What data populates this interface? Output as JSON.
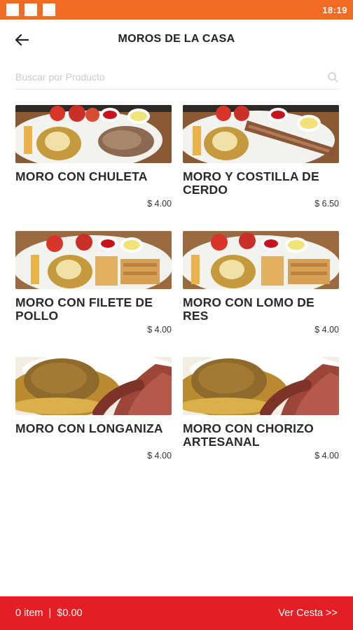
{
  "status_bar": {
    "time": "18:19",
    "color": "#f26b23"
  },
  "header": {
    "title": "MOROS DE LA CASA",
    "back_icon": "arrow-left-icon"
  },
  "search": {
    "placeholder": "Buscar por Producto",
    "value": ""
  },
  "products": [
    {
      "name": "MORO CON CHULETA",
      "price": "$ 4.00",
      "image": "moro-chuleta"
    },
    {
      "name": "MORO Y COSTILLA DE CERDO",
      "price": "$ 6.50",
      "image": "moro-costilla"
    },
    {
      "name": "MORO CON FILETE DE POLLO",
      "price": "$ 4.00",
      "image": "moro-filete"
    },
    {
      "name": "MORO CON LOMO DE RES",
      "price": "$ 4.00",
      "image": "moro-lomo"
    },
    {
      "name": "MORO CON LONGANIZA",
      "price": "$ 4.00",
      "image": "moro-longaniza"
    },
    {
      "name": "MORO CON CHORIZO ARTESANAL",
      "price": "$ 4.00",
      "image": "moro-chorizo"
    }
  ],
  "cart": {
    "items": "0 item",
    "divider": "|",
    "total": "$0.00",
    "view_label": "Ver Cesta >>",
    "color": "#e31e24"
  }
}
